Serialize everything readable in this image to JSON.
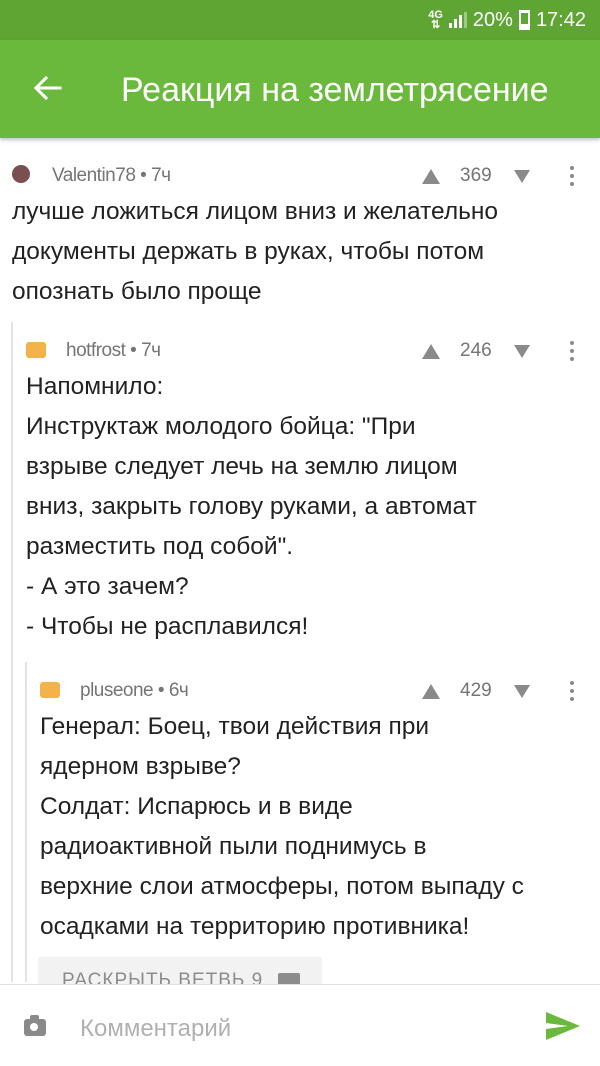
{
  "status_bar": {
    "network": "4G",
    "battery": "20%",
    "time": "17:42"
  },
  "app_bar": {
    "title": "Реакция на землетрясение"
  },
  "comments": [
    {
      "author": "Valentin78",
      "time": "7ч",
      "score": "369",
      "lines": [
        "лучше ложиться лицом вниз и желательно",
        "документы держать в руках, чтобы потом",
        "опознать было проще"
      ]
    },
    {
      "author": "hotfrost",
      "time": "7ч",
      "score": "246",
      "lines": [
        "Напомнило:",
        "Инструктаж молодого бойца: \"При",
        "взрыве следует лечь на землю лицом",
        "вниз, закрыть голову руками, а автомат",
        "разместить под собой\".",
        "- А это зачем?",
        "- Чтобы не расплавился!"
      ]
    },
    {
      "author": "pluseone",
      "time": "6ч",
      "score": "429",
      "lines": [
        "Генерал: Боец, твои действия при",
        "ядерном взрыве?",
        "Солдат: Испарюсь и в виде",
        "радиоактивной пыли поднимусь в",
        "верхние слои атмосферы, потом выпаду с",
        "осадками на территорию противника!"
      ]
    }
  ],
  "expand_thread": {
    "label": "РАСКРЫТЬ ВЕТВЬ",
    "count": "9"
  },
  "input": {
    "placeholder": "Комментарий"
  },
  "colors": {
    "status_bar": "#5fa534",
    "app_bar": "#6bb93c",
    "send": "#6bb93c"
  }
}
